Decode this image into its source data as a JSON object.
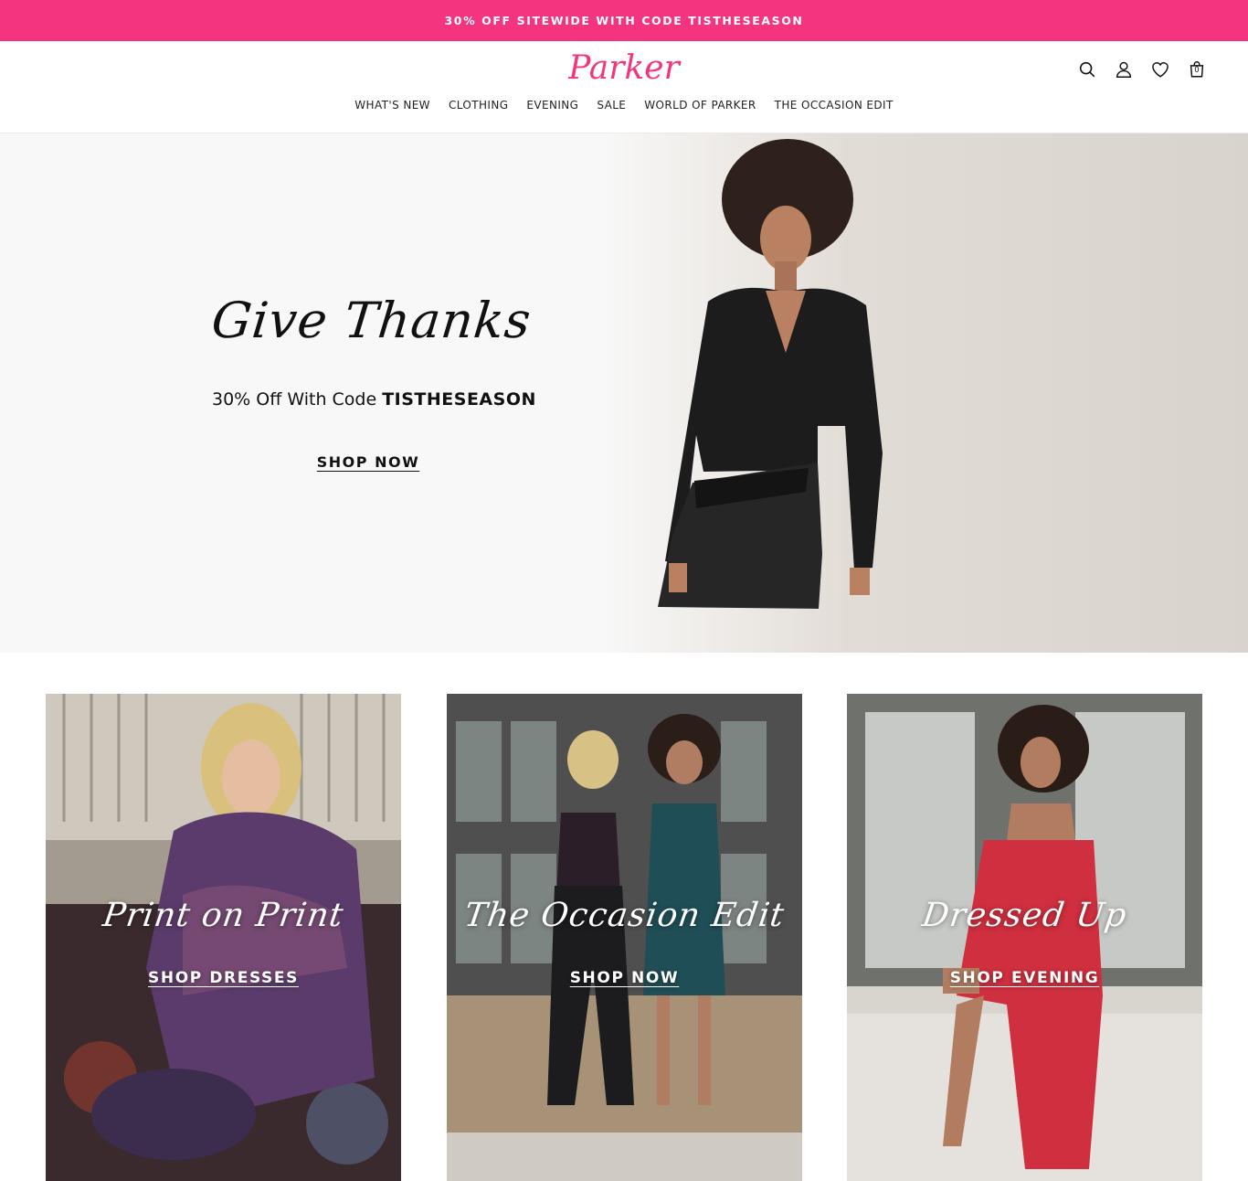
{
  "promo": {
    "text": "30% OFF SITEWIDE WITH CODE TISTHESEASON"
  },
  "header": {
    "logo": "Parker",
    "cart_count": "0",
    "icons": [
      "search-icon",
      "account-icon",
      "wishlist-heart-icon",
      "shopping-bag-icon"
    ],
    "nav": [
      "WHAT'S NEW",
      "CLOTHING",
      "EVENING",
      "SALE",
      "WORLD OF PARKER",
      "THE OCCASION EDIT"
    ]
  },
  "hero": {
    "title": "Give Thanks",
    "subtitle_prefix": "30% Off With Code ",
    "subtitle_code": "TISTHESEASON",
    "cta": "SHOP NOW"
  },
  "tiles": [
    {
      "title": "Print on Print",
      "cta": "SHOP DRESSES"
    },
    {
      "title": "The Occasion Edit",
      "cta": "SHOP NOW"
    },
    {
      "title": "Dressed Up",
      "cta": "SHOP EVENING"
    }
  ],
  "colors": {
    "accent": "#f5347f",
    "text": "#111111",
    "background": "#ffffff"
  }
}
